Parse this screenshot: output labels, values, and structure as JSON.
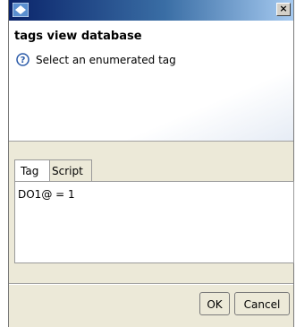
{
  "window": {
    "close_label": "×"
  },
  "header": {
    "title": "tags view database",
    "message": "Select an enumerated tag"
  },
  "tabs": [
    {
      "label": "Tag"
    },
    {
      "label": "Script"
    }
  ],
  "editor": {
    "content": "DO1@ = 1"
  },
  "buttons": {
    "ok": "OK",
    "cancel": "Cancel"
  },
  "colors": {
    "titlebar_start": "#0a246a",
    "titlebar_end": "#a6caf0",
    "dialog_bg": "#ece9d8"
  }
}
